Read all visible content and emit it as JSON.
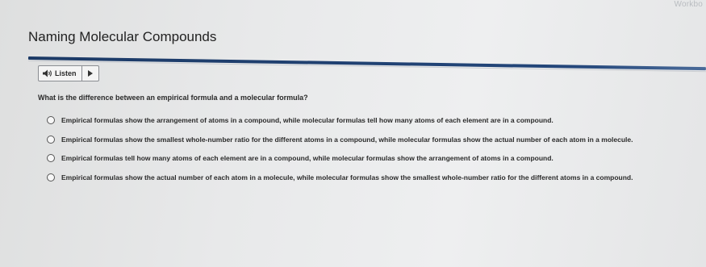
{
  "header": {
    "corner_text": "Workbo",
    "title": "Naming Molecular Compounds"
  },
  "audio": {
    "listen_label": "Listen",
    "icons": {
      "speaker": "speaker-icon",
      "play": "play-icon"
    }
  },
  "question": {
    "prompt": "What is the difference between an empirical formula and a molecular formula?",
    "options": [
      "Empirical formulas show the arrangement of atoms in a compound, while molecular formulas tell how many atoms of each element are in a compound.",
      "Empirical formulas show the smallest whole-number ratio for the different atoms in a compound, while molecular formulas show the actual number of each atom in a molecule.",
      "Empirical formulas tell how many atoms of each element are in a compound, while molecular formulas show the arrangement of atoms in a compound.",
      "Empirical formulas show the actual number of each atom in a molecule, while molecular formulas show the smallest whole-number ratio for the different atoms in a compound."
    ]
  },
  "colors": {
    "accent_rule": "#23467a",
    "text": "#2a2a2a",
    "background": "#e8e9ea"
  }
}
